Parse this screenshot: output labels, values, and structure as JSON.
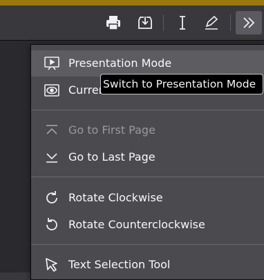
{
  "colors": {
    "accent": "#9a7810",
    "toolbar_bg": "#38383d",
    "menu_bg": "#4a4a4f",
    "highlight": "#5c5c61"
  },
  "toolbar": {
    "buttons": [
      {
        "icon": "print-icon"
      },
      {
        "icon": "download-icon"
      },
      {
        "icon": "text-cursor-icon"
      },
      {
        "icon": "pencil-icon"
      },
      {
        "icon": "double-chevron-right-icon"
      }
    ]
  },
  "menu": {
    "items": [
      {
        "label": "Presentation Mode",
        "icon": "presentation-icon",
        "state": "highlighted"
      },
      {
        "label": "Current",
        "icon": "eye-icon"
      },
      {
        "label": "Go to First Page",
        "icon": "first-page-icon",
        "state": "disabled"
      },
      {
        "label": "Go to Last Page",
        "icon": "last-page-icon"
      },
      {
        "label": "Rotate Clockwise",
        "icon": "rotate-cw-icon"
      },
      {
        "label": "Rotate Counterclockwise",
        "icon": "rotate-ccw-icon"
      },
      {
        "label": "Text Selection Tool",
        "icon": "pointer-cursor-icon"
      }
    ]
  },
  "tooltip": {
    "text": "Switch to Presentation Mode"
  }
}
